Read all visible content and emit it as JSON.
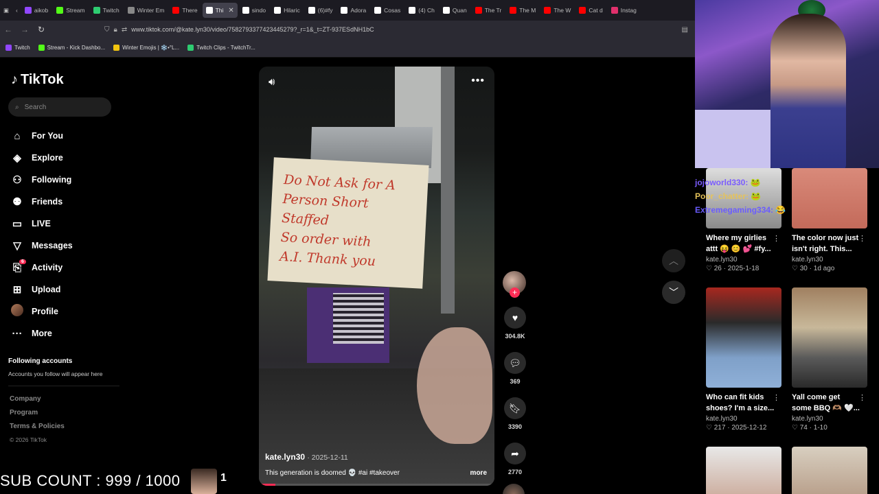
{
  "browser": {
    "tabs": [
      {
        "label": "aikob",
        "color": "#9147ff"
      },
      {
        "label": "Stream",
        "color": "#53fc18"
      },
      {
        "label": "Twitch",
        "color": "#2ecc71"
      },
      {
        "label": "Winter Em",
        "color": "#888888"
      },
      {
        "label": "There",
        "color": "#ff0000"
      },
      {
        "label": "Thi",
        "color": "#ffffff",
        "active": true
      },
      {
        "label": "sindo",
        "color": "#ffffff"
      },
      {
        "label": "Hilaric",
        "color": "#ffffff"
      },
      {
        "label": "(6)#fy",
        "color": "#ffffff"
      },
      {
        "label": "Adora",
        "color": "#ffffff"
      },
      {
        "label": "Cosas",
        "color": "#ffffff"
      },
      {
        "label": "(4) Ch",
        "color": "#ffffff"
      },
      {
        "label": "Quan",
        "color": "#ffffff"
      },
      {
        "label": "The Tr",
        "color": "#ff0000"
      },
      {
        "label": "The M",
        "color": "#ff0000"
      },
      {
        "label": "The W",
        "color": "#ff0000"
      },
      {
        "label": "Cat d",
        "color": "#ff0000"
      },
      {
        "label": "Instag",
        "color": "#e1306c"
      }
    ],
    "url": "www.tiktok.com/@kate.lyn30/video/7582793377423445279?_r=1&_t=ZT-937ESdNH1bC",
    "bookmarks": [
      {
        "label": "Twitch",
        "color": "#9147ff"
      },
      {
        "label": "Stream - Kick Dashbo...",
        "color": "#53fc18"
      },
      {
        "label": "Winter Emojis | ❄️•°L...",
        "color": "#f1c40f"
      },
      {
        "label": "Twitch Clips - TwitchTr...",
        "color": "#2ecc71"
      }
    ]
  },
  "sidebar": {
    "brand": "TikTok",
    "search_placeholder": "Search",
    "items": [
      {
        "label": "For You",
        "icon": "home-icon"
      },
      {
        "label": "Explore",
        "icon": "compass-icon"
      },
      {
        "label": "Following",
        "icon": "following-icon"
      },
      {
        "label": "Friends",
        "icon": "friends-icon"
      },
      {
        "label": "LIVE",
        "icon": "live-icon"
      },
      {
        "label": "Messages",
        "icon": "messages-icon"
      },
      {
        "label": "Activity",
        "icon": "activity-icon",
        "badge": "6"
      },
      {
        "label": "Upload",
        "icon": "upload-icon"
      },
      {
        "label": "Profile",
        "icon": "avatar"
      },
      {
        "label": "More",
        "icon": "more-icon"
      }
    ],
    "following_title": "Following accounts",
    "following_sub": "Accounts you follow will appear here",
    "footer": [
      "Company",
      "Program",
      "Terms & Policies"
    ],
    "copyright": "© 2026 TikTok"
  },
  "video": {
    "sign_lines": [
      "Do Not Ask for A",
      "Person Short Staffed",
      "So order with",
      "A.I. Thank you"
    ],
    "author": "kate.lyn30",
    "date": "· 2025-12-11",
    "caption": "This generation is doomed 💀 #ai #takeover",
    "more": "more",
    "progress": 0.07,
    "likes": "304.8K",
    "comments": "369",
    "saves": "3390",
    "shares": "2770"
  },
  "stream": {
    "chat": [
      "jojoworld330: 🐸",
      "Poor_chatter: 🐸",
      "Extremegaming334: 😂"
    ],
    "sub_count": "SUB COUNT : 999 / 1000",
    "sub_num": "1"
  },
  "recommended": [
    {
      "title": "Where my girlies attt 😝 😊 💕 #fy...",
      "user": "kate.lyn30",
      "likes": "26",
      "date": "2025-1-18",
      "bg": "linear-gradient(180deg,#ddd,#8a8a8a)"
    },
    {
      "title": "The color now just isn't right. This...",
      "user": "kate.lyn30",
      "likes": "30",
      "date": "1d ago",
      "bg": "linear-gradient(180deg,#d98a7a,#c36a5a)"
    },
    {
      "title": "Who can fit kids shoes? I'm a size...",
      "user": "kate.lyn30",
      "likes": "217",
      "date": "2025-12-12",
      "bg": "linear-gradient(180deg,#a8281f 0%,#2a2a2a 35%,#7fa0c8 70%,#8fb0d8 100%)"
    },
    {
      "title": "Yall come get some BBQ 🫶🏽 🤍...",
      "user": "kate.lyn30",
      "likes": "74",
      "date": "1-10",
      "bg": "linear-gradient(180deg,#a08060 0%,#c8b89a 40%,#5a5a5a 70%,#2a2a2a 100%)"
    },
    {
      "title": "",
      "user": "",
      "likes": "",
      "date": "",
      "bg": "linear-gradient(180deg,#e8e8e8,#caa898)"
    },
    {
      "title": "",
      "user": "",
      "likes": "",
      "date": "",
      "bg": "linear-gradient(180deg,#d8cfc0,#b59a85)"
    }
  ]
}
